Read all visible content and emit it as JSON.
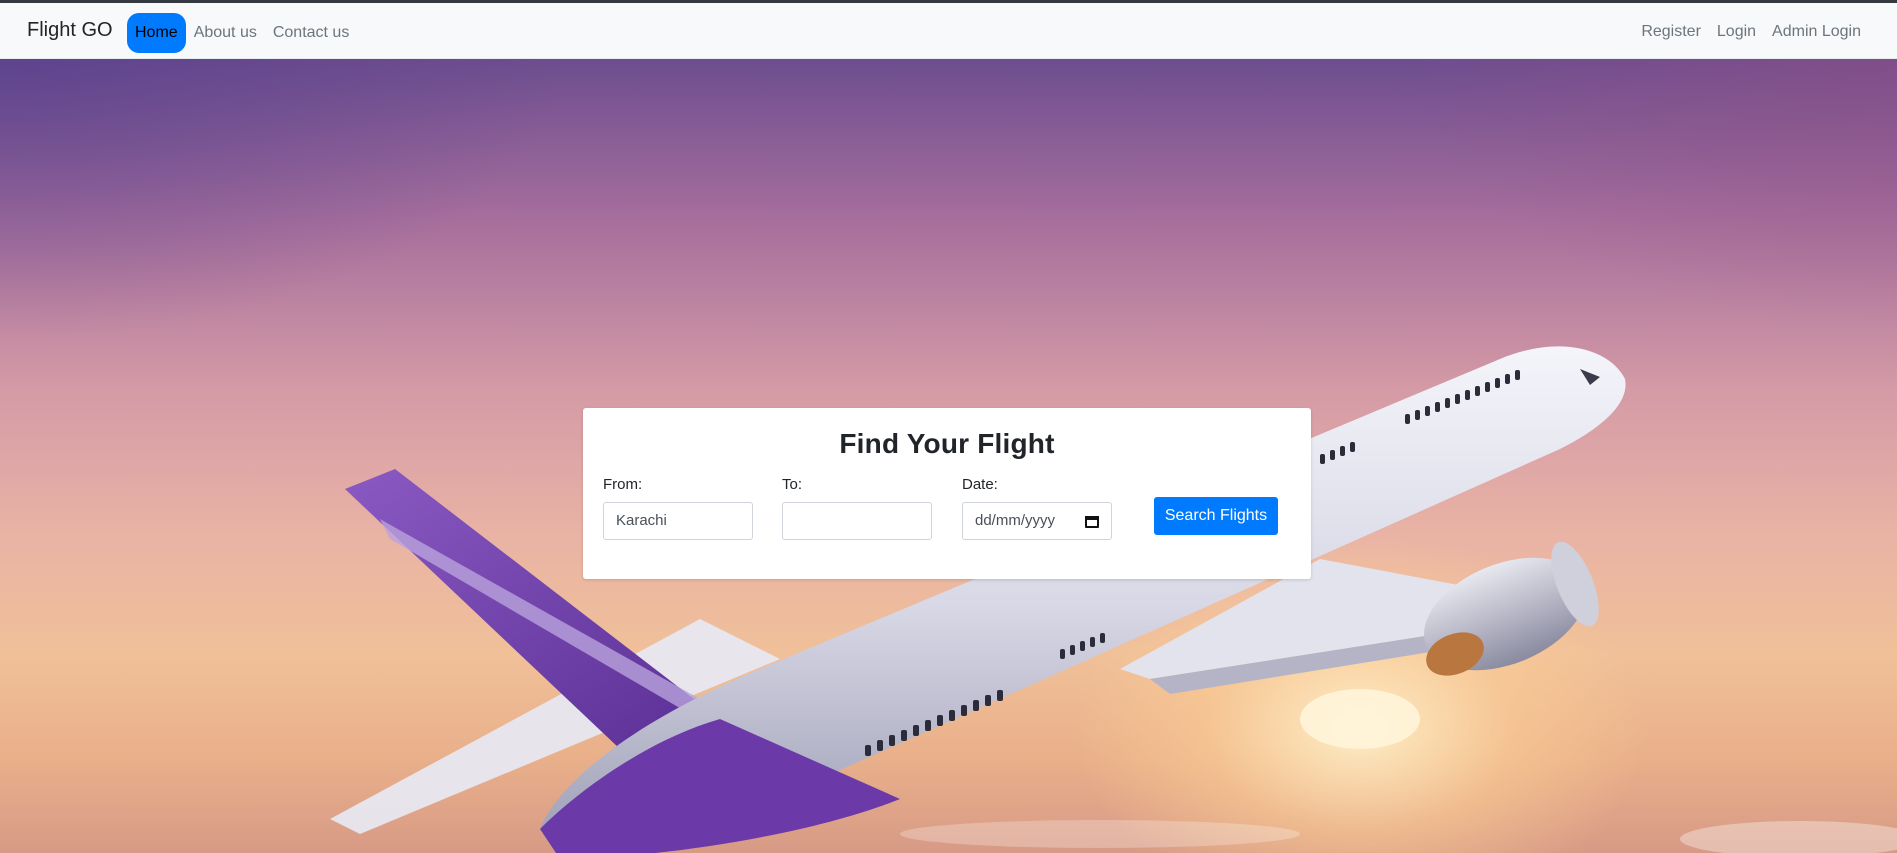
{
  "navbar": {
    "brand": "Flight GO",
    "left_links": [
      "Home",
      "About us",
      "Contact us"
    ],
    "active_link": "Home",
    "right_links": [
      "Register",
      "Login",
      "Admin Login"
    ]
  },
  "search_card": {
    "title": "Find Your Flight",
    "from_label": "From:",
    "from_value": "Karachi",
    "to_label": "To:",
    "to_value": "",
    "date_label": "Date:",
    "date_placeholder": "dd/mm/yyyy",
    "search_button": "Search Flights"
  },
  "icons": {
    "date_picker": "calendar-icon"
  },
  "colors": {
    "primary": "#007bff",
    "navbar_bg": "#f8f9fa",
    "nav_link": "#6c757d"
  }
}
